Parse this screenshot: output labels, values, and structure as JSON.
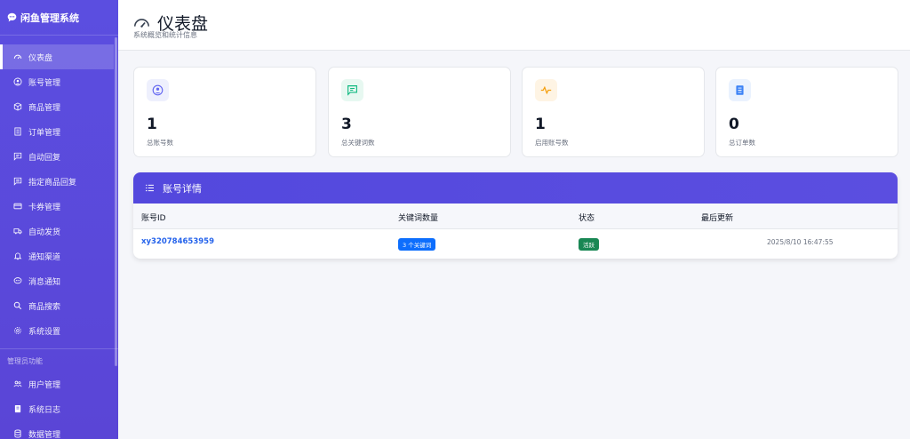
{
  "app": {
    "title": "闲鱼管理系统"
  },
  "sidebar": {
    "items": [
      {
        "label": "仪表盘",
        "icon": "speedometer-icon",
        "active": true
      },
      {
        "label": "账号管理",
        "icon": "user-circle-icon"
      },
      {
        "label": "商品管理",
        "icon": "box-icon"
      },
      {
        "label": "订单管理",
        "icon": "receipt-icon"
      },
      {
        "label": "自动回复",
        "icon": "chat-left-text-icon"
      },
      {
        "label": "指定商品回复",
        "icon": "chat-square-text-icon"
      },
      {
        "label": "卡券管理",
        "icon": "credit-card-icon"
      },
      {
        "label": "自动发货",
        "icon": "truck-icon"
      },
      {
        "label": "通知渠道",
        "icon": "bell-icon"
      },
      {
        "label": "消息通知",
        "icon": "chat-dots-icon"
      },
      {
        "label": "商品搜索",
        "icon": "search-icon"
      },
      {
        "label": "系统设置",
        "icon": "gear-icon"
      }
    ],
    "admin_section_label": "管理员功能",
    "admin_items": [
      {
        "label": "用户管理",
        "icon": "people-icon"
      },
      {
        "label": "系统日志",
        "icon": "journal-icon"
      },
      {
        "label": "数据管理",
        "icon": "database-icon"
      }
    ]
  },
  "header": {
    "title": "仪表盘",
    "subtitle": "系统概览和统计信息"
  },
  "stats": [
    {
      "value": "1",
      "label": "总账号数",
      "icon": "person-icon",
      "color": "#6366f1",
      "bg": "#eef0fd"
    },
    {
      "value": "3",
      "label": "总关键词数",
      "icon": "chat-icon",
      "color": "#10b981",
      "bg": "#e7f8f1"
    },
    {
      "value": "1",
      "label": "启用账号数",
      "icon": "activity-icon",
      "color": "#f59e0b",
      "bg": "#fef4e4"
    },
    {
      "value": "0",
      "label": "总订单数",
      "icon": "document-icon",
      "color": "#3b82f6",
      "bg": "#eaf2fe"
    }
  ],
  "accounts": {
    "title": "账号详情",
    "columns": [
      "账号ID",
      "关键词数量",
      "状态",
      "最后更新"
    ],
    "rows": [
      {
        "id": "xy320784653959",
        "keywords": "3 个关键词",
        "status": "活跃",
        "updated": "2025/8/10 16:47:55"
      }
    ]
  },
  "colors": {
    "sidebar": "#5b4ee0",
    "accent": "#2563eb",
    "success": "#198754",
    "primary_badge": "#0d6efd"
  }
}
